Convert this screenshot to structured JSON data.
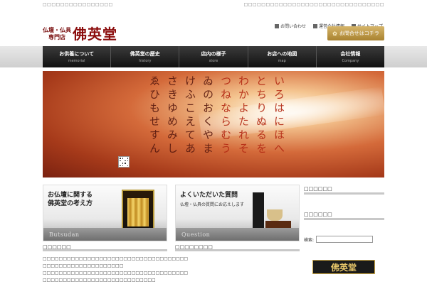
{
  "topstrip": {
    "left": "□□□□□□□□□□□□□□□□",
    "right": "□□□□□□□□□□□□□□□□□□□□□□□□□□□□□□□□"
  },
  "logo": {
    "sub_line1": "仏壇・仏具",
    "sub_line2": "専門店",
    "main": "佛英堂"
  },
  "toplinks": [
    {
      "label": "お問い合わせ"
    },
    {
      "label": "運営会社情報"
    },
    {
      "label": "サイトマップ"
    }
  ],
  "contact_button": {
    "label": "お問合せはコチラ"
  },
  "nav": [
    {
      "jp": "お供養について",
      "en": "memorial"
    },
    {
      "jp": "佛英堂の歴史",
      "en": "history"
    },
    {
      "jp": "店内の様子",
      "en": "store"
    },
    {
      "jp": "お店への地図",
      "en": "map"
    },
    {
      "jp": "会社情報",
      "en": "Company"
    }
  ],
  "hero": {
    "columns": [
      "いろはにほへ",
      "とちりぬるを",
      "わかよたれそ",
      "つねならむう",
      "ゐのおくやま",
      "けふこえてあ",
      "さきゆめみし",
      "ゑひもせすん"
    ]
  },
  "banners": {
    "butsudan": {
      "title_line1": "お仏壇に関する",
      "title_line2": "佛英堂の考え方",
      "en": "Butsudan"
    },
    "question": {
      "title": "よくいただいた質問",
      "sub": "仏壇・仏具の質問にお応えします",
      "en": "Question"
    }
  },
  "sections": {
    "left_head": "□□□□□□",
    "center_head": "□□□□□□□□",
    "para_line1": "□□□□□□□□□□□□□□□□□□□□□□□□□□□□□□□□□□□□",
    "para_line2": "□□□□□□□□□□□□□□□□□□□□",
    "para_line3": "□□□□□□□□□□□□□□□□□□□□□□□□□□□□□□□□□□□□",
    "para_line4": "□□□□□□□□□□□□□□□□□□□□□□□□□□□□"
  },
  "sidebar": {
    "head1": "□□□□□□",
    "head2": "□□□□□□",
    "search_label": "検索:",
    "search_value": "",
    "logo_text": "佛英堂"
  },
  "colors": {
    "brand_red": "#8b0c0c",
    "gold": "#c9a543",
    "nav_dark": "#1a1a1a"
  }
}
